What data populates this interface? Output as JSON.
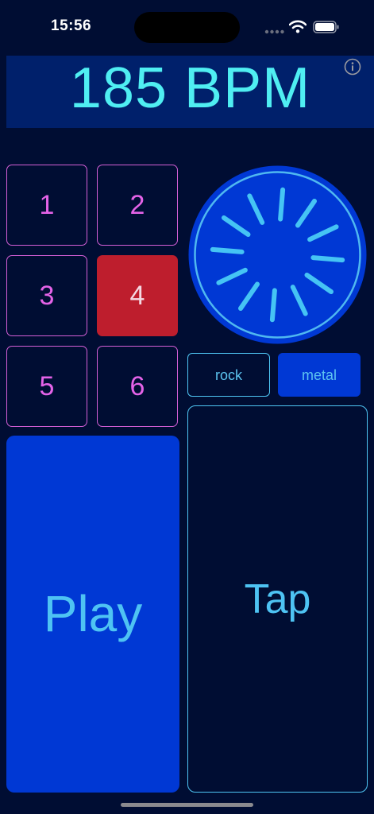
{
  "status_bar": {
    "time": "15:56"
  },
  "header": {
    "bpm": "185 BPM",
    "info_icon": "info-circle-icon"
  },
  "pads": {
    "items": [
      {
        "label": "1",
        "active": false
      },
      {
        "label": "2",
        "active": false
      },
      {
        "label": "3",
        "active": false
      },
      {
        "label": "4",
        "active": true
      },
      {
        "label": "5",
        "active": false
      },
      {
        "label": "6",
        "active": false
      }
    ]
  },
  "dial": {
    "icon": "rotary-knob-icon"
  },
  "styles": {
    "rock": "rock",
    "metal": "metal",
    "selected": "metal"
  },
  "controls": {
    "play": "Play",
    "tap": "Tap"
  },
  "colors": {
    "background": "#000d33",
    "header": "#00206b",
    "bpm_text": "#4feef2",
    "accent_blue": "#0038d4",
    "pad_border": "#d45fd6",
    "pad_active": "#be1e2d",
    "cyan_text": "#4ec3f3"
  }
}
